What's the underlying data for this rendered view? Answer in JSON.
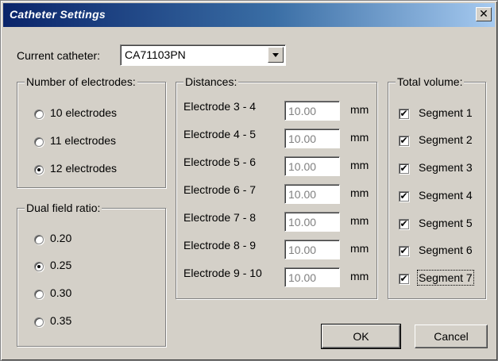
{
  "window": {
    "title": "Catheter Settings",
    "close_glyph": "✕"
  },
  "catheter": {
    "label": "Current catheter:",
    "value": "CA71103PN"
  },
  "electrodes": {
    "legend": "Number of electrodes:",
    "options": [
      {
        "label": "10 electrodes",
        "selected": false
      },
      {
        "label": "11 electrodes",
        "selected": false
      },
      {
        "label": "12 electrodes",
        "selected": true
      }
    ]
  },
  "dual_field": {
    "legend": "Dual field ratio:",
    "options": [
      {
        "label": "0.20",
        "selected": false
      },
      {
        "label": "0.25",
        "selected": true
      },
      {
        "label": "0.30",
        "selected": false
      },
      {
        "label": "0.35",
        "selected": false
      }
    ]
  },
  "distances": {
    "legend": "Distances:",
    "unit": "mm",
    "rows": [
      {
        "label": "Electrode 3 - 4",
        "value": "10.00"
      },
      {
        "label": "Electrode 4 - 5",
        "value": "10.00"
      },
      {
        "label": "Electrode 5 - 6",
        "value": "10.00"
      },
      {
        "label": "Electrode 6 - 7",
        "value": "10.00"
      },
      {
        "label": "Electrode 7 - 8",
        "value": "10.00"
      },
      {
        "label": "Electrode 8 - 9",
        "value": "10.00"
      },
      {
        "label": "Electrode 9 - 10",
        "value": "10.00"
      }
    ]
  },
  "total_volume": {
    "legend": "Total volume:",
    "check_glyph": "✔",
    "segments": [
      {
        "label": "Segment 1",
        "checked": true
      },
      {
        "label": "Segment 2",
        "checked": true
      },
      {
        "label": "Segment 3",
        "checked": true
      },
      {
        "label": "Segment 4",
        "checked": true
      },
      {
        "label": "Segment 5",
        "checked": true
      },
      {
        "label": "Segment 6",
        "checked": true
      },
      {
        "label": "Segment 7",
        "checked": true
      }
    ]
  },
  "buttons": {
    "ok": "OK",
    "cancel": "Cancel"
  }
}
